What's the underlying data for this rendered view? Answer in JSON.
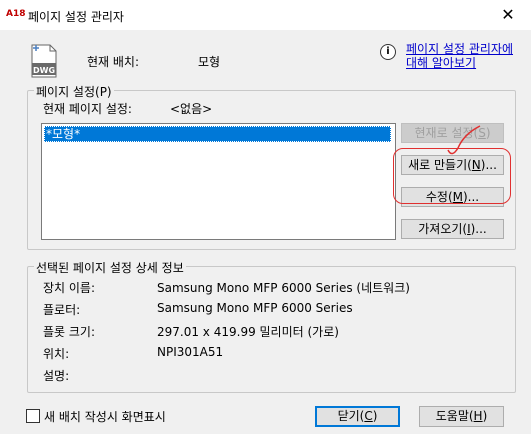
{
  "window": {
    "title": "페이지 설정 관리자",
    "app_icon_text": "A18",
    "close_symbol": "✕"
  },
  "header": {
    "dwg_badge": "DWG",
    "current_layout_label": "현재 배치:",
    "current_layout_value": "모형",
    "help_icon": "i",
    "help_link_line1": "페이지 설정 관리자에",
    "help_link_line2": "대해 알아보기"
  },
  "page_setups": {
    "group_label": "페이지 설정(P)",
    "current_label": "현재 페이지 설정:",
    "current_value": "<없음>",
    "list_items": [
      "*모형*"
    ],
    "buttons": {
      "set_current": {
        "prefix": "현재로 설정(",
        "key": "S",
        "suffix": ")"
      },
      "new": {
        "prefix": "새로 만들기(",
        "key": "N",
        "suffix": ")..."
      },
      "modify": {
        "prefix": "수정(",
        "key": "M",
        "suffix": ")..."
      },
      "import": {
        "prefix": "가져오기(",
        "key": "I",
        "suffix": ")..."
      }
    }
  },
  "details": {
    "group_label": "선택된 페이지 설정 상세 정보",
    "rows": [
      {
        "label": "장치 이름:",
        "value": "Samsung Mono MFP 6000 Series (네트워크)"
      },
      {
        "label": "플로터:",
        "value": "Samsung Mono MFP 6000 Series"
      },
      {
        "label": "플롯 크기:",
        "value": "297.01 x 419.99 밀리미터 (가로)"
      },
      {
        "label": "위치:",
        "value": "NPI301A51"
      },
      {
        "label": "설명:",
        "value": ""
      }
    ]
  },
  "footer": {
    "checkbox_label": "새 배치 작성시 화면표시",
    "close_button": {
      "prefix": "닫기(",
      "key": "C",
      "suffix": ")"
    },
    "help_button": {
      "prefix": "도움말(",
      "key": "H",
      "suffix": ")"
    }
  },
  "colors": {
    "selection": "#0078d7",
    "link": "#0000cc",
    "annotation": "#e03030"
  }
}
